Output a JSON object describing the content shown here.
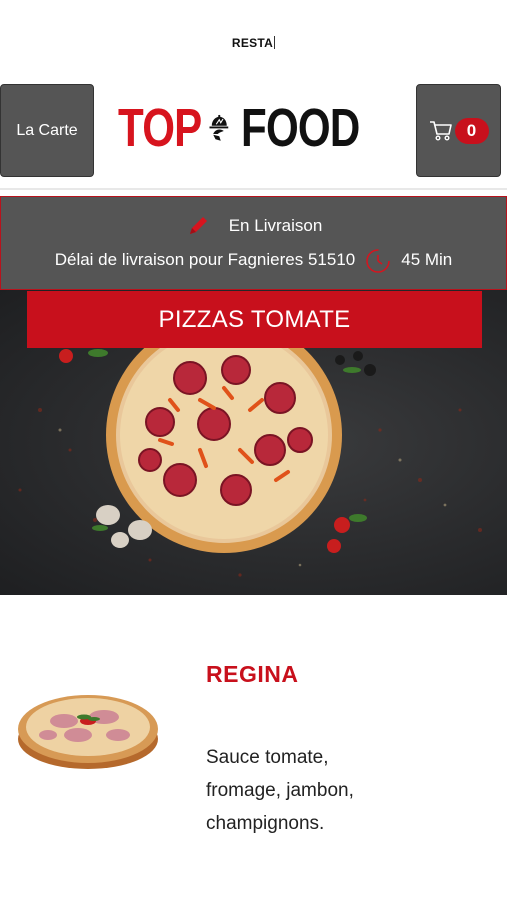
{
  "top_bar": {
    "title": "RESTA"
  },
  "header": {
    "menu_label": "La Carte",
    "logo": {
      "text_left": "TOP",
      "text_right": "FOOD"
    },
    "cart": {
      "count": "0"
    }
  },
  "delivery": {
    "mode": "En Livraison",
    "delay_label": "Délai de livraison pour Fagnieres 51510",
    "delay_value": "45 Min"
  },
  "category": {
    "title": "PIZZAS TOMATE"
  },
  "product": {
    "name": "REGINA",
    "description": "Sauce tomate, fromage, jambon, champignons."
  },
  "colors": {
    "brand_red": "#c8101c",
    "panel_gray": "#555555"
  },
  "icons": [
    "cart-icon",
    "pencil-icon",
    "timer-icon",
    "chef-cloche-logo"
  ]
}
